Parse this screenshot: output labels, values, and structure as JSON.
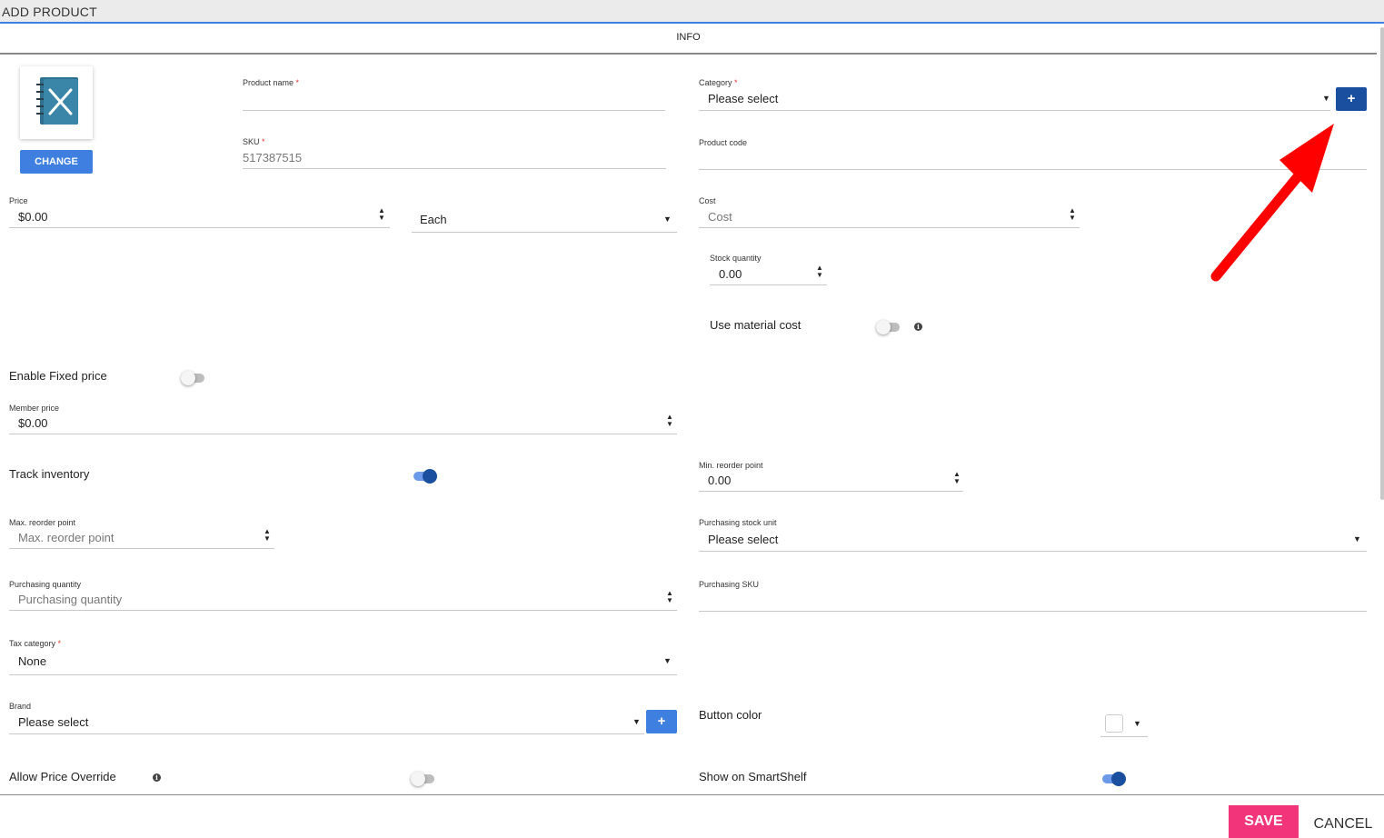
{
  "window": {
    "title": "ADD PRODUCT"
  },
  "tabs": {
    "active": "INFO"
  },
  "image": {
    "change_label": "CHANGE"
  },
  "fields": {
    "product_name": {
      "label": "Product name",
      "required": "*",
      "value": ""
    },
    "sku": {
      "label": "SKU",
      "required": "*",
      "value": "517387515"
    },
    "category": {
      "label": "Category",
      "required": "*",
      "value": "Please select",
      "add_label": "+"
    },
    "product_code": {
      "label": "Product code",
      "value": ""
    },
    "price": {
      "label": "Price",
      "value": "$0.00"
    },
    "unit": {
      "value": "Each"
    },
    "cost": {
      "label": "Cost",
      "placeholder": "Cost"
    },
    "stock_quantity": {
      "label": "Stock quantity",
      "value": "0.00"
    },
    "use_material_cost": {
      "label": "Use material cost",
      "on": false
    },
    "enable_fixed_price": {
      "label": "Enable Fixed price",
      "on": false
    },
    "member_price": {
      "label": "Member price",
      "value": "$0.00"
    },
    "track_inventory": {
      "label": "Track inventory",
      "on": true
    },
    "min_reorder_point": {
      "label": "Min. reorder point",
      "value": "0.00"
    },
    "max_reorder_point": {
      "label": "Max. reorder point",
      "placeholder": "Max. reorder point"
    },
    "purchasing_stock_unit": {
      "label": "Purchasing stock unit",
      "value": "Please select"
    },
    "purchasing_quantity": {
      "label": "Purchasing quantity",
      "placeholder": "Purchasing quantity"
    },
    "purchasing_sku": {
      "label": "Purchasing SKU",
      "value": ""
    },
    "tax_category": {
      "label": "Tax category",
      "required": "*",
      "value": "None"
    },
    "brand": {
      "label": "Brand",
      "value": "Please select",
      "add_label": "+"
    },
    "button_color": {
      "label": "Button color",
      "color": "#ffffff"
    },
    "allow_price_override": {
      "label": "Allow Price Override",
      "on": false
    },
    "show_on_smartshelf": {
      "label": "Show on SmartShelf",
      "on": true
    }
  },
  "footer": {
    "save_label": "SAVE",
    "cancel_label": "CANCEL"
  },
  "icons": {
    "spinner_up": "▲",
    "spinner_down": "▼",
    "dropdown": "▼",
    "info": "i"
  },
  "colors": {
    "accent": "#3f7fe0",
    "accent_dark": "#1a4fa0",
    "save": "#f2357a",
    "required": "#e53935",
    "annotation_arrow": "#ff0000"
  }
}
